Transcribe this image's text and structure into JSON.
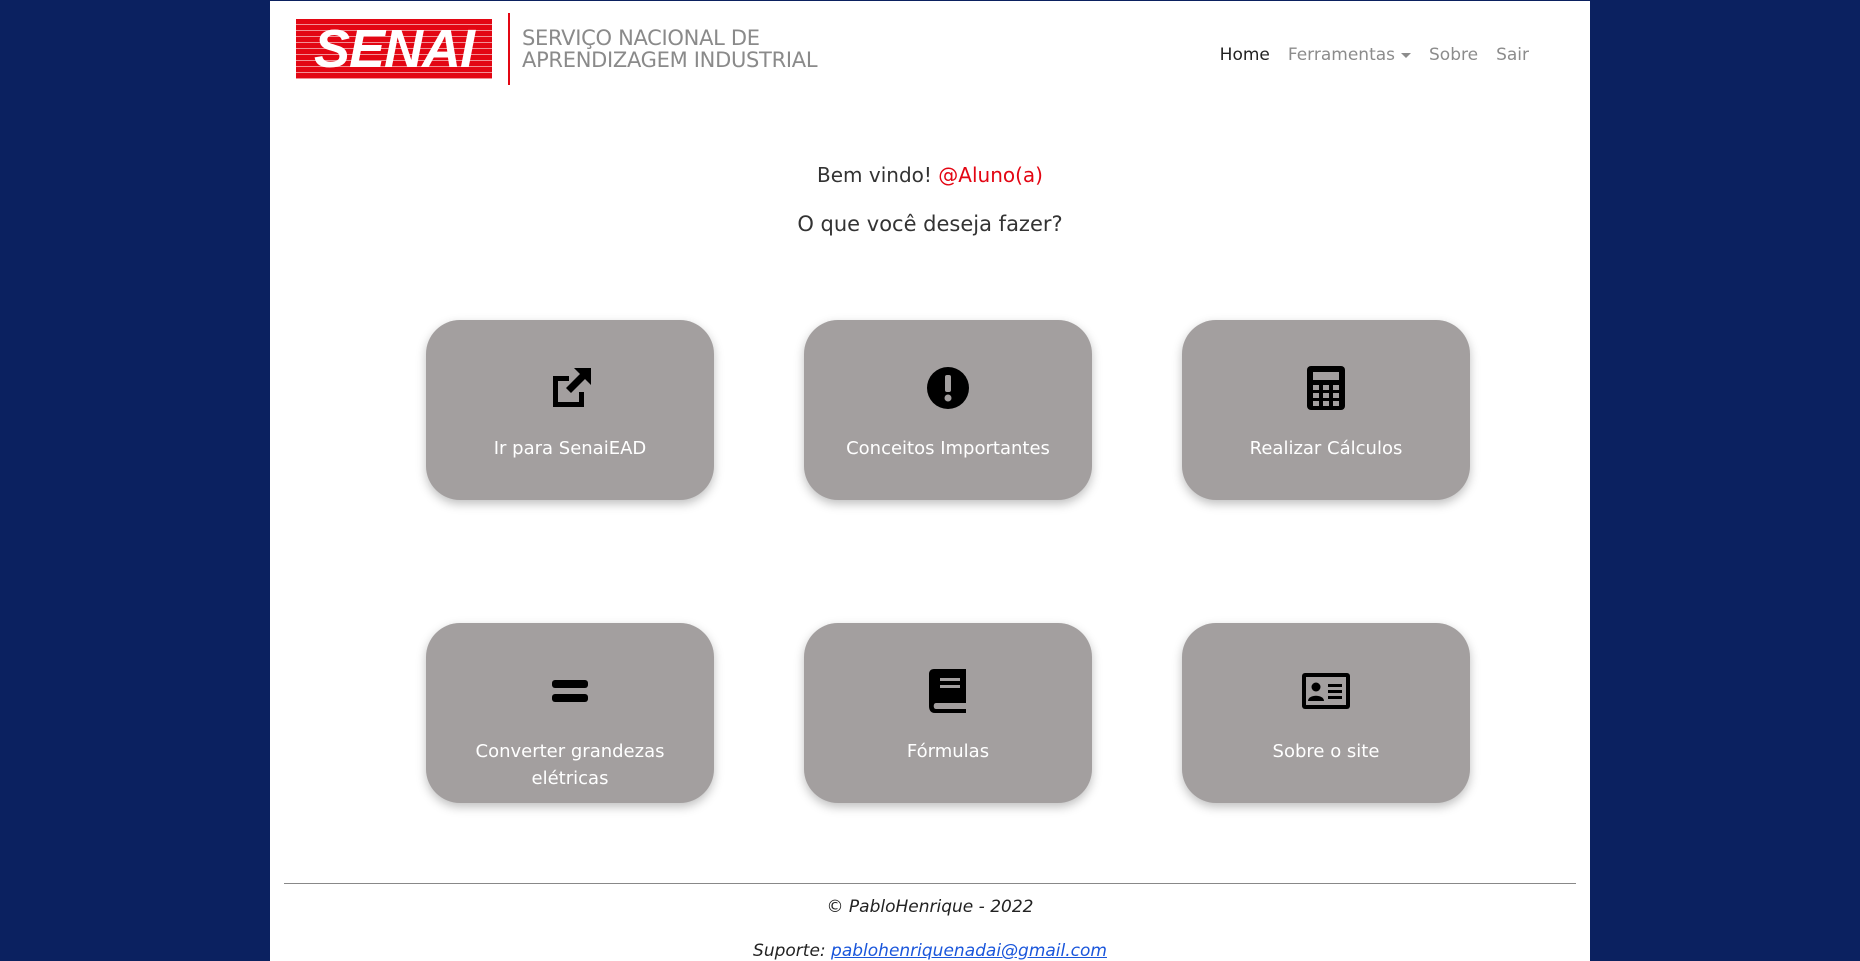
{
  "header": {
    "logo_word": "SENAI",
    "logo_text_line1": "SERVIÇO NACIONAL DE",
    "logo_text_line2": "APRENDIZAGEM INDUSTRIAL",
    "nav": {
      "home": "Home",
      "tools": "Ferramentas",
      "about": "Sobre",
      "logout": "Sair"
    }
  },
  "main": {
    "welcome_prefix": "Bem vindo!",
    "welcome_user": "@Aluno(a)",
    "question": "O que você deseja fazer?",
    "cards": [
      {
        "label": "Ir para SenaiEAD",
        "icon": "external-link-icon"
      },
      {
        "label": "Conceitos Importantes",
        "icon": "exclamation-circle-icon"
      },
      {
        "label": "Realizar Cálculos",
        "icon": "calculator-icon"
      },
      {
        "label": "Converter grandezas elétricas",
        "icon": "equals-icon"
      },
      {
        "label": "Fórmulas",
        "icon": "book-icon"
      },
      {
        "label": "Sobre o site",
        "icon": "id-card-icon"
      }
    ]
  },
  "footer": {
    "copyright": "© PabloHenrique - 2022",
    "support_label": "Suporte:",
    "support_email": "pablohenriquenadai@gmail.com"
  },
  "colors": {
    "background": "#0b2160",
    "brand_red": "#e30613",
    "card": "#a39f9f",
    "link": "#1a56db"
  }
}
